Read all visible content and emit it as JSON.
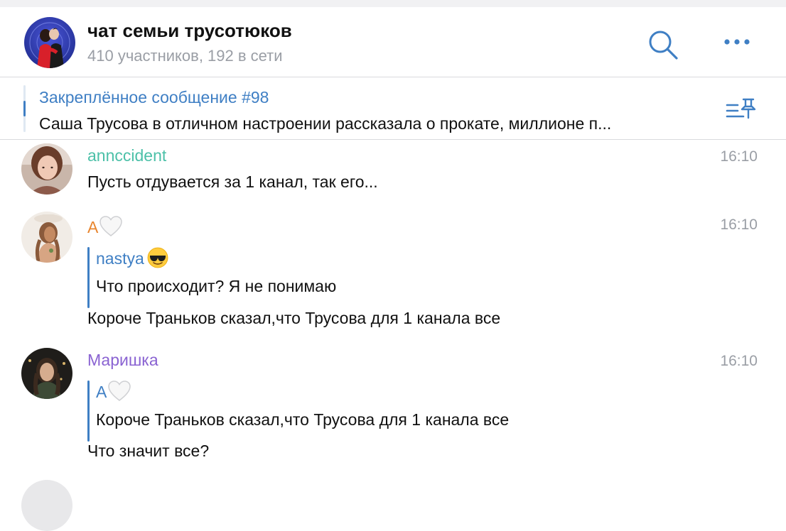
{
  "header": {
    "title": "чат семьи трусотюков",
    "subtitle": "410 участников, 192 в сети"
  },
  "pinned": {
    "title": "Закреплённое сообщение #98",
    "text": "Саша Трусова в отличном настроении рассказала о прокате, миллионе п..."
  },
  "messages": [
    {
      "author": "annccident",
      "author_color": "#4cc0a8",
      "time": "16:10",
      "text": "Пусть отдувается за 1 канал, так его..."
    },
    {
      "author": "А",
      "author_color": "#e8852e",
      "author_emoji": "white-heart",
      "time": "16:10",
      "reply_author": "nastya",
      "reply_author_emoji": "smiling-face-with-sunglasses",
      "reply_text": "Что происходит? Я не понимаю",
      "text": "Короче Траньков сказал,что Трусова для 1 канала все"
    },
    {
      "author": "Маришка",
      "author_color": "#8a63d2",
      "time": "16:10",
      "reply_author": "А",
      "reply_author_emoji": "white-heart",
      "reply_text": "Короче Траньков сказал,что Трусова для 1 канала все",
      "text": "Что значит все?"
    }
  ],
  "colors": {
    "accent": "#3f7fc4",
    "secondary_text": "#9a9ea5",
    "divider": "#d9dadd"
  }
}
